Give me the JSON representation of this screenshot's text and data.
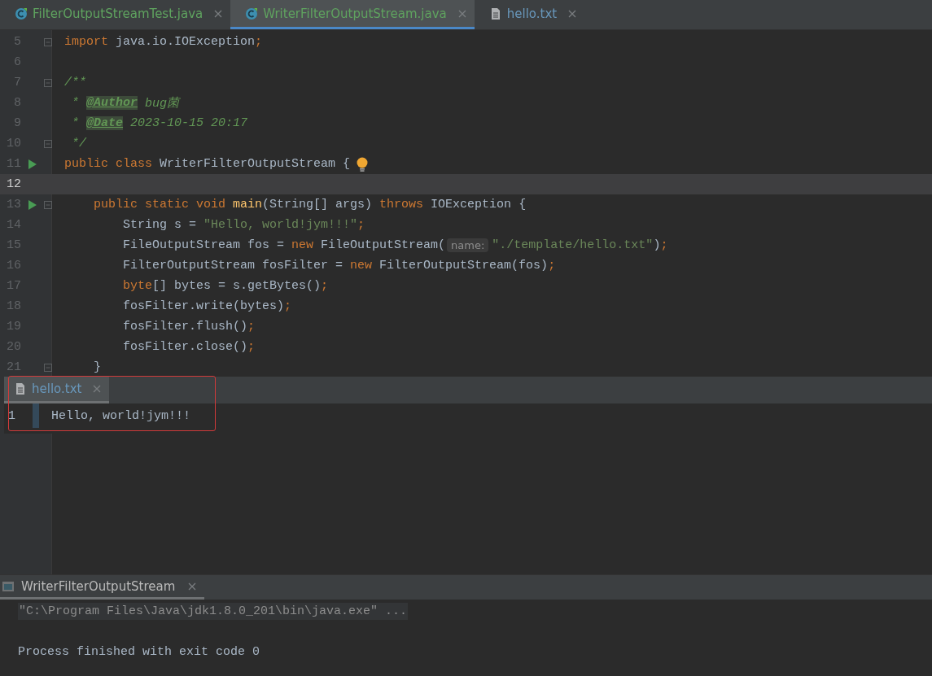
{
  "tabs": [
    {
      "label": "FilterOutputStreamTest.java",
      "kind": "java",
      "selected": false
    },
    {
      "label": "WriterFilterOutputStream.java",
      "kind": "java",
      "selected": true
    },
    {
      "label": "hello.txt",
      "kind": "text",
      "selected": false
    }
  ],
  "code_lines": [
    {
      "number": "5",
      "fold": true,
      "run": false,
      "bulb": false,
      "current": false,
      "tokens": [
        {
          "kind": "keyword",
          "text": "import "
        },
        {
          "kind": "plain",
          "text": "java.io.IOException"
        },
        {
          "kind": "keyword",
          "text": ";"
        }
      ]
    },
    {
      "number": "6",
      "fold": false,
      "run": false,
      "bulb": false,
      "current": false
    },
    {
      "number": "7",
      "fold": true,
      "run": false,
      "bulb": false,
      "current": false,
      "tokens": [
        {
          "kind": "comment",
          "text": "/**"
        }
      ]
    },
    {
      "number": "8",
      "fold": false,
      "run": false,
      "bulb": false,
      "current": false,
      "tokens": [
        {
          "kind": "comment",
          "text": " * "
        },
        {
          "kind": "doctag",
          "text": "@Author"
        },
        {
          "kind": "comment",
          "text": " bug菌"
        }
      ]
    },
    {
      "number": "9",
      "fold": false,
      "run": false,
      "bulb": false,
      "current": false,
      "tokens": [
        {
          "kind": "comment",
          "text": " * "
        },
        {
          "kind": "doctag",
          "text": "@Date"
        },
        {
          "kind": "comment",
          "text": " 2023-10-15 20:17"
        }
      ]
    },
    {
      "number": "10",
      "fold": true,
      "run": false,
      "bulb": false,
      "current": false,
      "tokens": [
        {
          "kind": "comment",
          "text": " */"
        }
      ]
    },
    {
      "number": "11",
      "fold": false,
      "run": true,
      "bulb": true,
      "current": false,
      "tokens": [
        {
          "kind": "keyword",
          "text": "public class "
        },
        {
          "kind": "plain",
          "text": "WriterFilterOutputStream {"
        }
      ]
    },
    {
      "number": "12",
      "fold": false,
      "run": false,
      "bulb": false,
      "current": true
    },
    {
      "number": "13",
      "fold": true,
      "run": true,
      "bulb": false,
      "current": false,
      "tokens": [
        {
          "kind": "keyword",
          "text": "    public static void "
        },
        {
          "kind": "method",
          "text": "main"
        },
        {
          "kind": "plain",
          "text": "(String[] args) "
        },
        {
          "kind": "keyword",
          "text": "throws "
        },
        {
          "kind": "plain",
          "text": "IOException {"
        }
      ]
    },
    {
      "number": "14",
      "fold": false,
      "run": false,
      "bulb": false,
      "current": false,
      "tokens": [
        {
          "kind": "plain",
          "text": "        String s = "
        },
        {
          "kind": "string",
          "text": "\"Hello, world!jym!!!\""
        },
        {
          "kind": "keyword",
          "text": ";"
        }
      ]
    },
    {
      "number": "15",
      "fold": false,
      "run": false,
      "bulb": false,
      "current": false,
      "tokens": [
        {
          "kind": "plain",
          "text": "        FileOutputStream fos = "
        },
        {
          "kind": "keyword",
          "text": "new "
        },
        {
          "kind": "plain",
          "text": "FileOutputStream("
        },
        {
          "kind": "hint",
          "text": "name:"
        },
        {
          "kind": "string",
          "text": "\"./template/hello.txt\""
        },
        {
          "kind": "plain",
          "text": ")"
        },
        {
          "kind": "keyword",
          "text": ";"
        }
      ]
    },
    {
      "number": "16",
      "fold": false,
      "run": false,
      "bulb": false,
      "current": false,
      "tokens": [
        {
          "kind": "plain",
          "text": "        FilterOutputStream fosFilter = "
        },
        {
          "kind": "keyword",
          "text": "new "
        },
        {
          "kind": "plain",
          "text": "FilterOutputStream(fos)"
        },
        {
          "kind": "keyword",
          "text": ";"
        }
      ]
    },
    {
      "number": "17",
      "fold": false,
      "run": false,
      "bulb": false,
      "current": false,
      "tokens": [
        {
          "kind": "keyword",
          "text": "        byte"
        },
        {
          "kind": "plain",
          "text": "[] bytes = s.getBytes()"
        },
        {
          "kind": "keyword",
          "text": ";"
        }
      ]
    },
    {
      "number": "18",
      "fold": false,
      "run": false,
      "bulb": false,
      "current": false,
      "tokens": [
        {
          "kind": "plain",
          "text": "        fosFilter.write(bytes)"
        },
        {
          "kind": "keyword",
          "text": ";"
        }
      ]
    },
    {
      "number": "19",
      "fold": false,
      "run": false,
      "bulb": false,
      "current": false,
      "tokens": [
        {
          "kind": "plain",
          "text": "        fosFilter.flush()"
        },
        {
          "kind": "keyword",
          "text": ";"
        }
      ]
    },
    {
      "number": "20",
      "fold": false,
      "run": false,
      "bulb": false,
      "current": false,
      "tokens": [
        {
          "kind": "plain",
          "text": "        fosFilter.close()"
        },
        {
          "kind": "keyword",
          "text": ";"
        }
      ]
    },
    {
      "number": "21",
      "fold": true,
      "run": false,
      "bulb": false,
      "current": false,
      "tokens": [
        {
          "kind": "plain",
          "text": "    }"
        }
      ]
    }
  ],
  "preview": {
    "tab": {
      "label": "hello.txt",
      "selected": true
    },
    "lines": [
      {
        "number": "1",
        "text": "Hello, world!jym!!!"
      }
    ]
  },
  "run_panel": {
    "tab": {
      "label": "WriterFilterOutputStream",
      "selected": true
    },
    "output": [
      {
        "kind": "command",
        "text": "\"C:\\Program Files\\Java\\jdk1.8.0_201\\bin\\java.exe\" ..."
      },
      {
        "kind": "blank"
      },
      {
        "kind": "plain",
        "text": "Process finished with exit code 0"
      }
    ]
  }
}
